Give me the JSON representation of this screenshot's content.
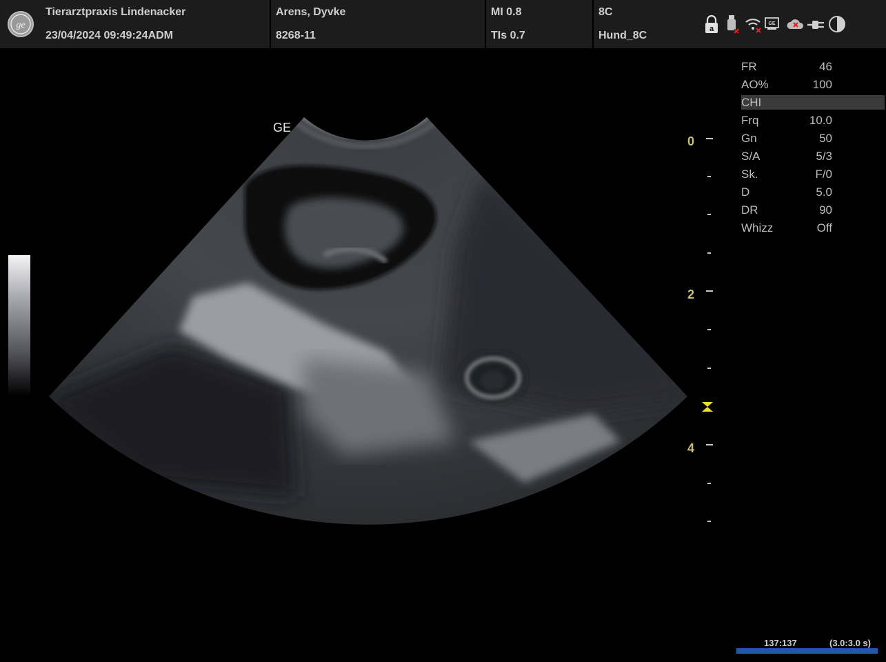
{
  "header": {
    "clinic": "Tierarztpraxis Lindenacker",
    "datetime": "23/04/2024 09:49:24ADM",
    "patient_name": "Arens, Dyvke",
    "patient_id": "8268-11",
    "mi": "MI 0.8",
    "tis": "TIs 0.7",
    "probe": "8C",
    "preset": "Hund_8C"
  },
  "status_icons": [
    "keyboard-lock-icon",
    "usb-disconnected-icon",
    "wifi-disconnected-icon",
    "network-card-icon",
    "cloud-disconnected-icon",
    "power-plug-icon",
    "contrast-icon"
  ],
  "parameters": [
    {
      "label": "FR",
      "value": "46"
    },
    {
      "label": "AO%",
      "value": "100"
    },
    {
      "label": "CHI",
      "value": "",
      "highlight": true
    },
    {
      "label": "Frq",
      "value": "10.0"
    },
    {
      "label": "Gn",
      "value": "50"
    },
    {
      "label": "S/A",
      "value": "5/3"
    },
    {
      "label": "Sk.",
      "value": "F/0"
    },
    {
      "label": "D",
      "value": "5.0"
    },
    {
      "label": "DR",
      "value": "90"
    },
    {
      "label": "Whizz",
      "value": "Off"
    }
  ],
  "image": {
    "brand_label": "GE",
    "depth_labels": [
      "0",
      "2",
      "4"
    ]
  },
  "cine": {
    "frames": "137:137",
    "duration": "(3.0:3.0 s)"
  },
  "colors": {
    "header_bg": "#1c1c1c",
    "depth_label": "#c8c07a",
    "focus_marker": "#e8e020",
    "cine_bar": "#1e5aa8"
  }
}
